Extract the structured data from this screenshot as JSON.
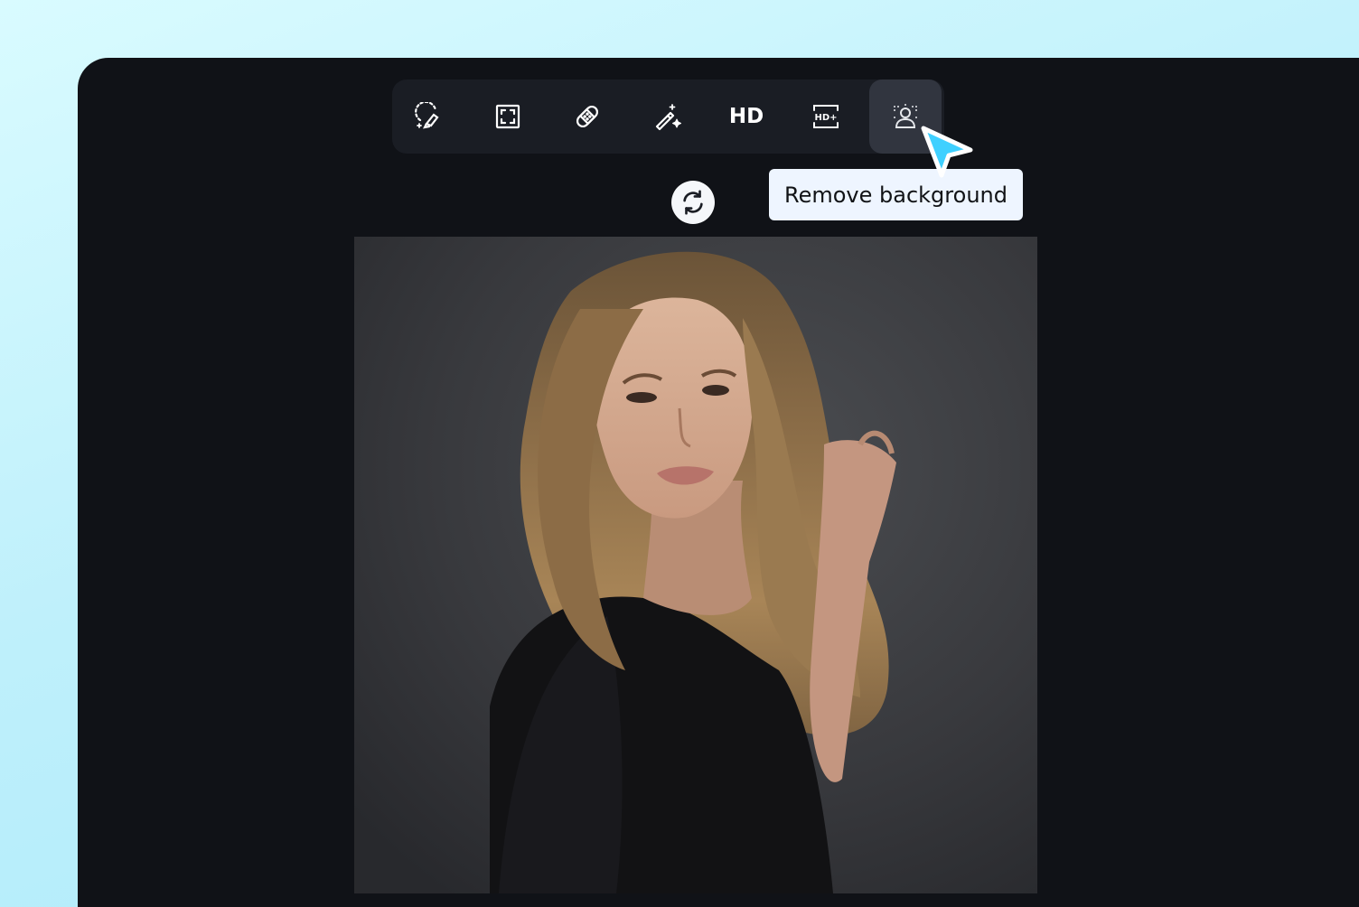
{
  "toolbar": {
    "tools": [
      {
        "name": "lasso-brush",
        "icon": "lasso-brush-icon"
      },
      {
        "name": "expand",
        "icon": "expand-frame-icon"
      },
      {
        "name": "heal",
        "icon": "bandage-icon"
      },
      {
        "name": "magic",
        "icon": "magic-wand-icon"
      },
      {
        "name": "hd",
        "icon": "hd-icon",
        "label": "HD"
      },
      {
        "name": "hd-plus",
        "icon": "hd-plus-icon",
        "label": "HD+"
      },
      {
        "name": "remove-background",
        "icon": "person-scan-icon",
        "active": true
      }
    ]
  },
  "tooltip": {
    "text": "Remove background"
  },
  "refresh": {
    "icon": "refresh-icon"
  },
  "photo": {
    "subject": "portrait-photo"
  },
  "colors": {
    "page_background": "#c4f3fd",
    "window_background": "#101217",
    "toolbar_background": "#1a1d24",
    "active_tool_background": "#31353f",
    "tooltip_background": "#eef5ff",
    "cursor_fill": "#3fd0ff"
  }
}
